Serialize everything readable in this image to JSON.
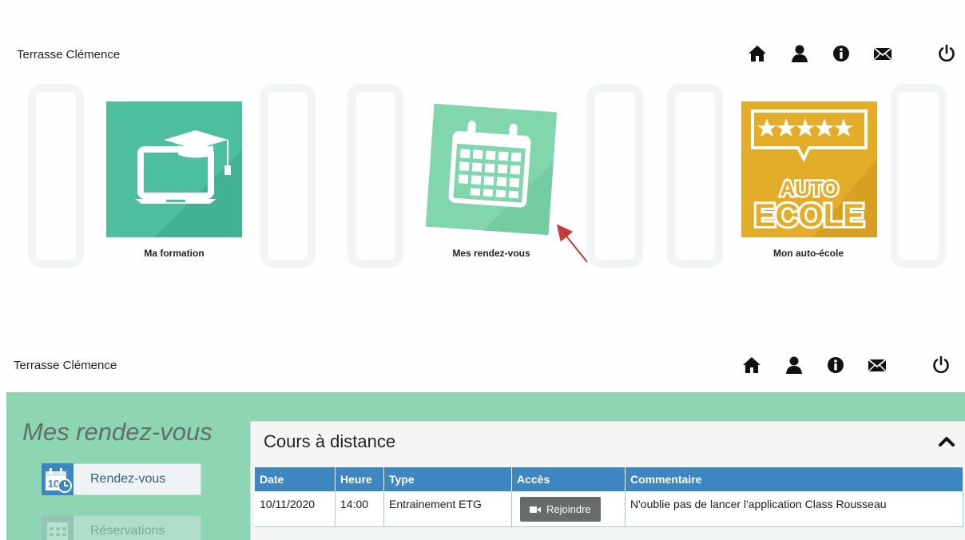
{
  "screen1": {
    "user_name": "Terrasse Clémence",
    "nav_icons": [
      "home-icon",
      "user-icon",
      "info-icon",
      "mail-icon",
      "power-icon"
    ],
    "tiles": [
      {
        "label": "Ma formation",
        "icon": "laptop-graduation-icon",
        "color": "#4dbf9e"
      },
      {
        "label": "Mes rendez-vous",
        "icon": "calendar-icon",
        "color": "#82d6ad"
      },
      {
        "label": "Mon auto-école",
        "icon": "auto-ecole-rating-icon",
        "color": "#e3ad2a",
        "logo_text_1": "AUTO",
        "logo_text_2": "ECOLE"
      }
    ]
  },
  "screen2": {
    "user_name": "Terrasse Clémence",
    "nav_icons": [
      "home-icon",
      "user-icon",
      "info-icon",
      "mail-icon",
      "power-icon"
    ],
    "panel_title": "Mes rendez-vous",
    "sidebar": [
      {
        "label": "Rendez-vous",
        "icon": "calendar-clock-icon",
        "calendar_number": "10"
      },
      {
        "label": "Réservations",
        "icon": "calendar-grid-icon"
      }
    ],
    "card": {
      "title": "Cours à distance",
      "columns": [
        "Date",
        "Heure",
        "Type",
        "Accès",
        "Commentaire"
      ],
      "rows": [
        {
          "date": "10/11/2020",
          "heure": "14:00",
          "type": "Entrainement ETG",
          "acces": "Rejoindre",
          "commentaire": "N'oublie pas de lancer l'application Class Rousseau"
        }
      ]
    }
  },
  "colors": {
    "panel_green": "#8ed5b3",
    "table_header_blue": "#3d86c1",
    "join_button": "#676c6a",
    "arrow_red": "#c73a3a"
  }
}
